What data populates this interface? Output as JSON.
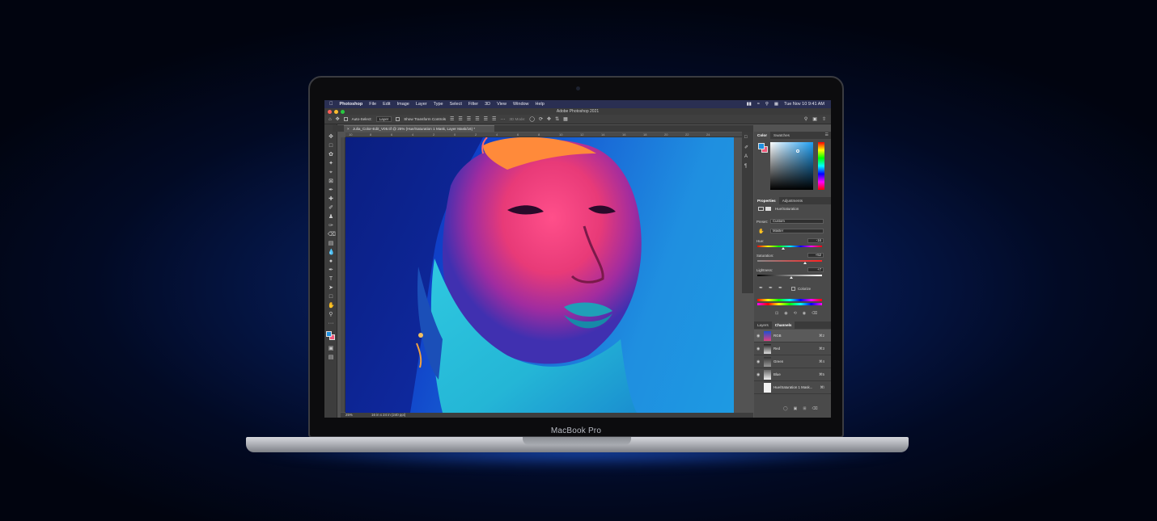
{
  "menubar": {
    "apple": "",
    "app": "Photoshop",
    "items": [
      "File",
      "Edit",
      "Image",
      "Layer",
      "Type",
      "Select",
      "Filter",
      "3D",
      "View",
      "Window",
      "Help"
    ],
    "datetime": "Tue Nov 10  9:41 AM"
  },
  "window": {
    "title": "Adobe Photoshop 2021"
  },
  "options": {
    "auto_select_label": "Auto-Select:",
    "auto_select_value": "Layer",
    "transform_label": "Show Transform Controls",
    "mode_3d_label": "3D Mode:"
  },
  "document": {
    "tab_title": "Julia_Color-Edit_V05.tif @ 25% (Hue/Saturation 1 Mask, Layer Mask/16) *",
    "zoom": "25%",
    "doc_info": "16 in x 24 in (240 ppi)",
    "ruler_marks": [
      "10",
      "8",
      "6",
      "4",
      "2",
      "0",
      "2",
      "4",
      "6",
      "8",
      "10",
      "12",
      "14",
      "16",
      "18",
      "20",
      "22",
      "24"
    ]
  },
  "color_panel": {
    "tabs": [
      "Color",
      "Swatches"
    ],
    "foreground": "#1e8fe0",
    "background": "#f0587a"
  },
  "properties": {
    "tabs": [
      "Properties",
      "Adjustments"
    ],
    "title": "Hue/Saturation",
    "preset_label": "Preset:",
    "preset_value": "Custom",
    "channel_value": "Master",
    "hue_label": "Hue:",
    "hue_value": "-16",
    "saturation_label": "Saturation:",
    "saturation_value": "+52",
    "lightness_label": "Lightness:",
    "lightness_value": "+7",
    "colorize_label": "Colorize"
  },
  "channels_panel": {
    "tabs": [
      "Layers",
      "Channels"
    ],
    "rows": [
      {
        "name": "RGB",
        "key": "⌘2"
      },
      {
        "name": "Red",
        "key": "⌘3"
      },
      {
        "name": "Green",
        "key": "⌘4"
      },
      {
        "name": "Blue",
        "key": "⌘5"
      },
      {
        "name": "Hue/Saturation 1 Mask...",
        "key": "⌘\\"
      }
    ]
  },
  "laptop": {
    "label": "MacBook Pro"
  }
}
